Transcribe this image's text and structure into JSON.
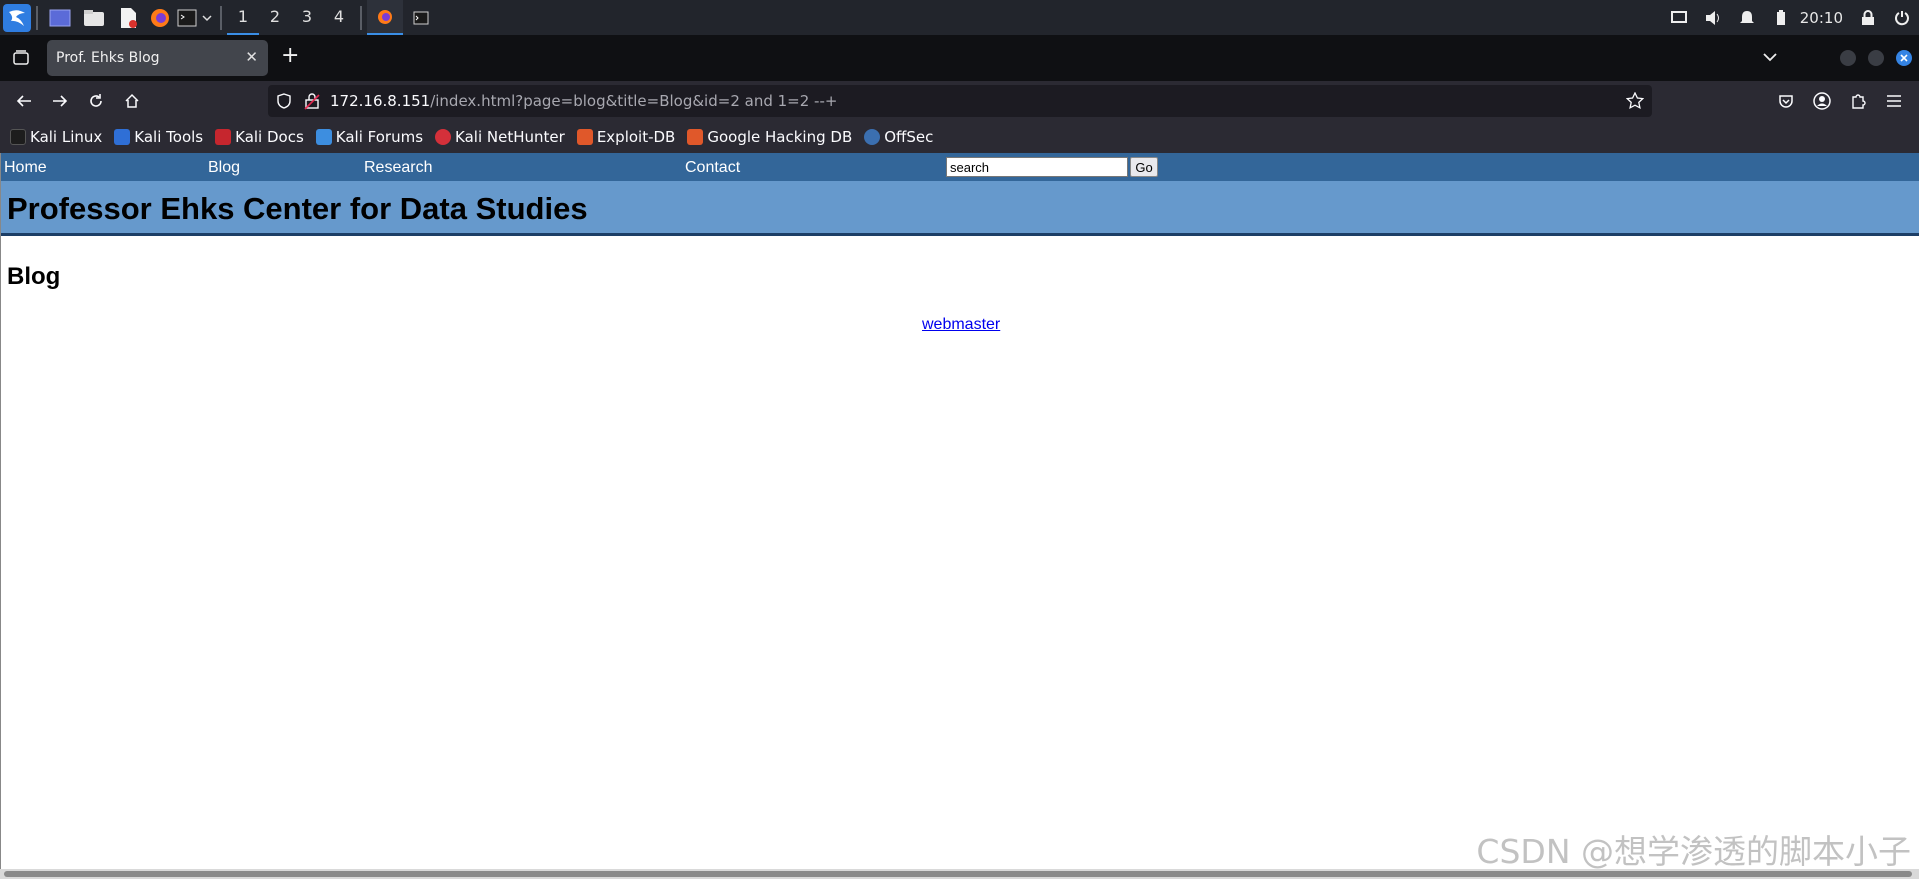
{
  "taskbar": {
    "workspaces": [
      "1",
      "2",
      "3",
      "4"
    ],
    "active_workspace": "1",
    "clock": "20:10"
  },
  "browser": {
    "tab_title": "Prof. Ehks Blog",
    "url_host": "172.16.8.151",
    "url_path": "/index.html?page=blog&title=Blog&id=2 and 1=2 --+",
    "bookmarks": [
      {
        "label": "Kali Linux",
        "icon": "kali-dragon-icon"
      },
      {
        "label": "Kali Tools",
        "icon": "kali-tools-icon"
      },
      {
        "label": "Kali Docs",
        "icon": "kali-docs-icon"
      },
      {
        "label": "Kali Forums",
        "icon": "kali-forums-icon"
      },
      {
        "label": "Kali NetHunter",
        "icon": "nethunter-icon"
      },
      {
        "label": "Exploit-DB",
        "icon": "exploit-db-icon"
      },
      {
        "label": "Google Hacking DB",
        "icon": "ghdb-icon"
      },
      {
        "label": "OffSec",
        "icon": "offsec-icon"
      }
    ]
  },
  "site": {
    "nav": {
      "home": "Home",
      "blog": "Blog",
      "research": "Research",
      "contact": "Contact"
    },
    "search": {
      "value": "search",
      "button": "Go"
    },
    "header_title": "Professor Ehks Center for Data Studies",
    "page_heading": "Blog",
    "author_link": "webmaster"
  },
  "watermark": "CSDN @想学渗透的脚本小子",
  "colors": {
    "site_nav_bg": "#336699",
    "site_header_bg": "#6699cc",
    "link": "#0000ee",
    "taskbar_bg": "#22252c",
    "browser_toolbar_bg": "#2b2a33"
  }
}
